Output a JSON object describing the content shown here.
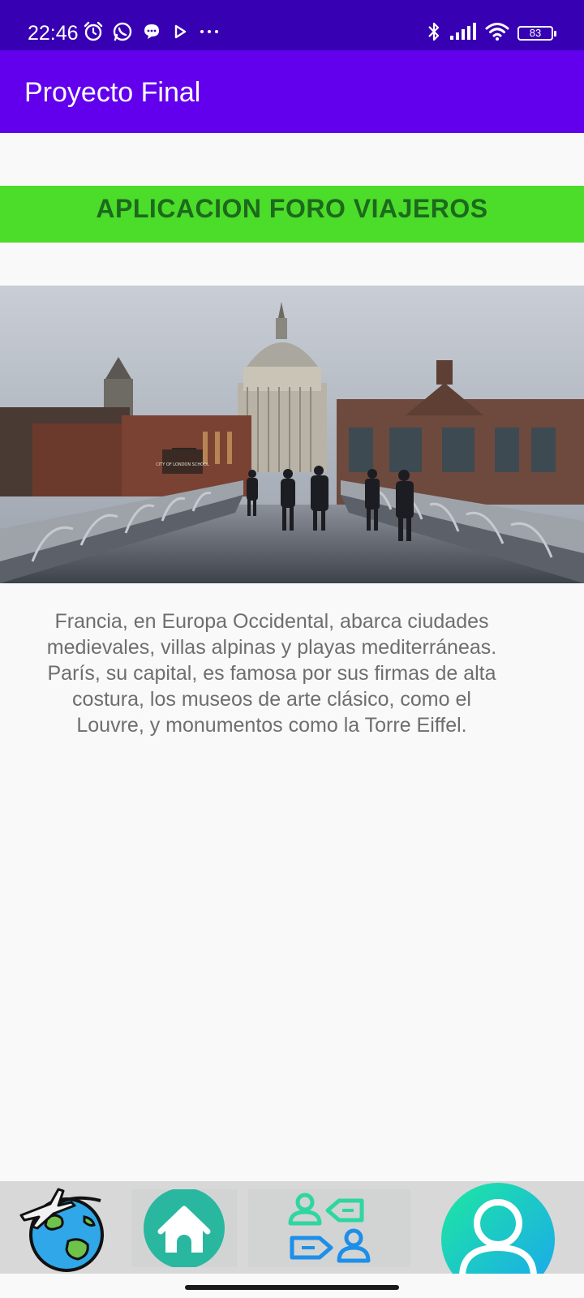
{
  "status_bar": {
    "time": "22:46",
    "battery_level": "83",
    "left_icons": [
      "alarm-icon",
      "whatsapp-icon",
      "chat-bubble-icon",
      "play-icon",
      "more-dots-icon"
    ],
    "right_icons": [
      "bluetooth-icon",
      "signal-icon",
      "wifi-icon",
      "battery-icon"
    ]
  },
  "app_bar": {
    "title": "Proyecto Final"
  },
  "banner": {
    "text": "APLICACION FORO VIAJEROS",
    "background_color": "#4cdc2a",
    "text_color": "#1c6a1c"
  },
  "photo": {
    "sign_text": "CITY OF LONDON SCHOOL"
  },
  "description": "Francia, en Europa Occidental, abarca ciudades medievales, villas alpinas y playas mediterráneas. París, su capital, es famosa por sus firmas de alta costura, los museos de arte clásico, como el Louvre, y monumentos como la Torre Eiffel.",
  "bottom_nav": {
    "items": [
      {
        "icon": "globe-plane-icon"
      },
      {
        "icon": "home-icon"
      },
      {
        "icon": "forum-users-icon"
      },
      {
        "icon": "user-profile-icon"
      }
    ]
  },
  "colors": {
    "status_bar": "#3700b3",
    "app_bar": "#6200ee",
    "background": "#f9f9f9",
    "nav_background": "#d8d8d8"
  }
}
